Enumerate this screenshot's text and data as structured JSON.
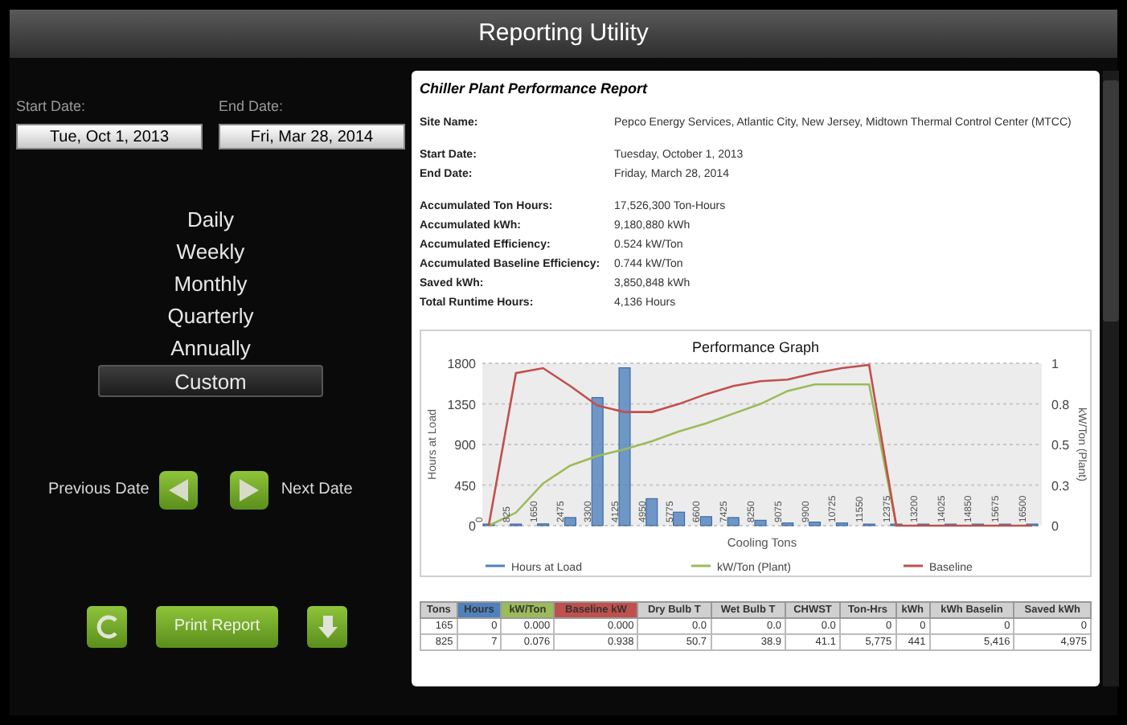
{
  "window": {
    "title": "Reporting Utility"
  },
  "date_range": {
    "start_label": "Start Date:",
    "start_value": "Tue, Oct 1, 2013",
    "end_label": "End Date:",
    "end_value": "Fri, Mar 28, 2014"
  },
  "periods": [
    {
      "label": "Daily",
      "selected": false
    },
    {
      "label": "Weekly",
      "selected": false
    },
    {
      "label": "Monthly",
      "selected": false
    },
    {
      "label": "Quarterly",
      "selected": false
    },
    {
      "label": "Annually",
      "selected": false
    },
    {
      "label": "Custom",
      "selected": true
    }
  ],
  "navigation": {
    "previous_label": "Previous Date",
    "next_label": "Next Date"
  },
  "actions": {
    "print_label": "Print Report"
  },
  "report": {
    "title": "Chiller Plant Performance Report",
    "groups": [
      [
        {
          "label": "Site Name:",
          "value": "Pepco Energy Services, Atlantic City, New Jersey, Midtown Thermal Control Center (MTCC)"
        }
      ],
      [
        {
          "label": "Start Date:",
          "value": "Tuesday, October 1, 2013"
        },
        {
          "label": "End Date:",
          "value": "Friday, March 28, 2014"
        }
      ],
      [
        {
          "label": "Accumulated Ton Hours:",
          "value": "17,526,300 Ton-Hours"
        },
        {
          "label": "Accumulated kWh:",
          "value": "9,180,880 kWh"
        },
        {
          "label": "Accumulated Efficiency:",
          "value": "0.524 kW/Ton"
        },
        {
          "label": "Accumulated Baseline Efficiency:",
          "value": "0.744 kW/Ton"
        },
        {
          "label": "Saved kWh:",
          "value": "3,850,848 kWh"
        },
        {
          "label": "Total Runtime Hours:",
          "value": "4,136 Hours"
        }
      ]
    ],
    "chart_data": {
      "type": "bar",
      "title": "Performance Graph",
      "xlabel": "Cooling Tons",
      "ylabel": "Hours at Load",
      "y2label": "kW/Ton (Plant)",
      "categories": [
        "0",
        "825",
        "1650",
        "2475",
        "3300",
        "4125",
        "4950",
        "5775",
        "6600",
        "7425",
        "8250",
        "9075",
        "9900",
        "10725",
        "11550",
        "12375",
        "13200",
        "14025",
        "14850",
        "15675",
        "16500"
      ],
      "grid": true,
      "legend": true,
      "ylim": [
        0,
        1800
      ],
      "yticks": [
        0,
        450,
        900,
        1350,
        1800
      ],
      "y2lim": [
        0,
        1
      ],
      "y2ticks": [
        0,
        {
          "value": 0.25,
          "label": "0.3"
        },
        0.5,
        {
          "value": 0.75,
          "label": "0.8"
        },
        1
      ],
      "series": [
        {
          "name": "Hours at Load",
          "color": "#4f81bd",
          "axis": "y",
          "values": [
            0,
            10,
            20,
            90,
            1420,
            1750,
            300,
            150,
            100,
            90,
            60,
            30,
            40,
            30,
            10,
            0,
            0,
            0,
            0,
            0,
            0
          ]
        },
        {
          "name": "kW/Ton (Plant)",
          "color": "#9bbb59",
          "type": "line",
          "axis": "y2",
          "values": [
            0,
            0.08,
            0.26,
            0.37,
            0.43,
            0.47,
            0.52,
            0.58,
            0.63,
            0.69,
            0.75,
            0.83,
            0.87,
            0.87,
            0.87,
            0,
            null,
            null,
            null,
            null,
            null
          ]
        },
        {
          "name": "Baseline",
          "color": "#c0504d",
          "type": "line",
          "axis": "y2",
          "values": [
            0,
            0.94,
            0.97,
            0.86,
            0.74,
            0.7,
            0.7,
            0.75,
            0.81,
            0.86,
            0.89,
            0.9,
            0.94,
            0.97,
            0.99,
            0,
            0,
            0,
            0,
            0,
            0
          ]
        }
      ]
    },
    "table": {
      "columns": [
        {
          "label": "Tons",
          "color": "#d0d0d0"
        },
        {
          "label": "Hours",
          "color": "#4f81bd"
        },
        {
          "label": "kW/Ton",
          "color": "#9bbb59"
        },
        {
          "label": "Baseline kW",
          "color": "#c0504d"
        },
        {
          "label": "Dry Bulb T",
          "color": "#d0d0d0"
        },
        {
          "label": "Wet Bulb T",
          "color": "#d0d0d0"
        },
        {
          "label": "CHWST",
          "color": "#d0d0d0"
        },
        {
          "label": "Ton-Hrs",
          "color": "#d0d0d0"
        },
        {
          "label": "kWh",
          "color": "#d0d0d0"
        },
        {
          "label": "kWh Baselin",
          "color": "#d0d0d0"
        },
        {
          "label": "Saved kWh",
          "color": "#d0d0d0"
        }
      ],
      "rows": [
        [
          "165",
          "0",
          "0.000",
          "0.000",
          "0.0",
          "0.0",
          "0.0",
          "0",
          "0",
          "0",
          "0"
        ],
        [
          "825",
          "7",
          "0.076",
          "0.938",
          "50.7",
          "38.9",
          "41.1",
          "5,775",
          "441",
          "5,416",
          "4,975"
        ]
      ]
    }
  }
}
